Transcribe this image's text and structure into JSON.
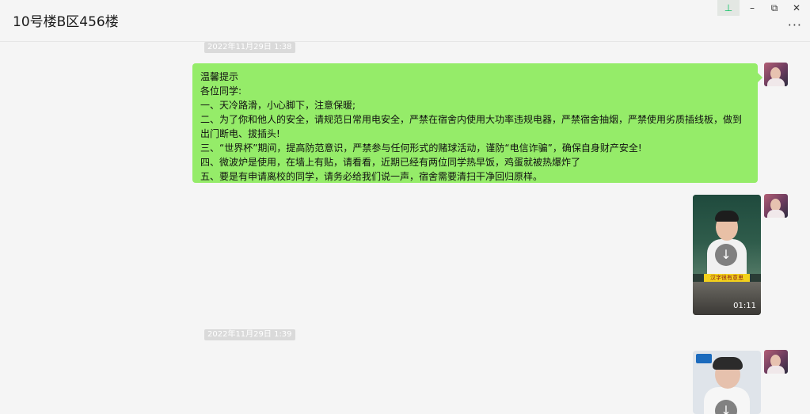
{
  "window": {
    "title": "10号楼B区456楼",
    "more_label": "···"
  },
  "controls": {
    "pin": "⊥",
    "minimize": "–",
    "restore": "⧉",
    "close": "✕"
  },
  "messages": {
    "ts1": "2022年11月29日 1:38",
    "ts2": "2022年11月29日 1:39",
    "notice_lines": [
      "温馨提示",
      "各位同学:",
      "一、天冷路滑，小心脚下，注意保暖;",
      "二、为了你和他人的安全，请规范日常用电安全，严禁在宿舍内使用大功率违规电器，严禁宿舍抽烟，严禁使用劣质插线板，做到出门断电、拔插头!",
      "三、“世界杯”期间，提高防范意识，严禁参与任何形式的赌球活动，谨防“电信诈骗”，确保自身财产安全!",
      "四、微波炉是使用，在墙上有贴，请看看，近期已经有两位同学热早饭，鸡蛋就被热爆炸了",
      "五、要是有申请离校的同学，请务必给我们说一声，宿舍需要清扫干净回归原样。"
    ],
    "video1": {
      "duration": "01:11",
      "caption": "汉字很有意思",
      "download_glyph": "↓"
    },
    "video2": {
      "download_glyph": "↓"
    }
  }
}
